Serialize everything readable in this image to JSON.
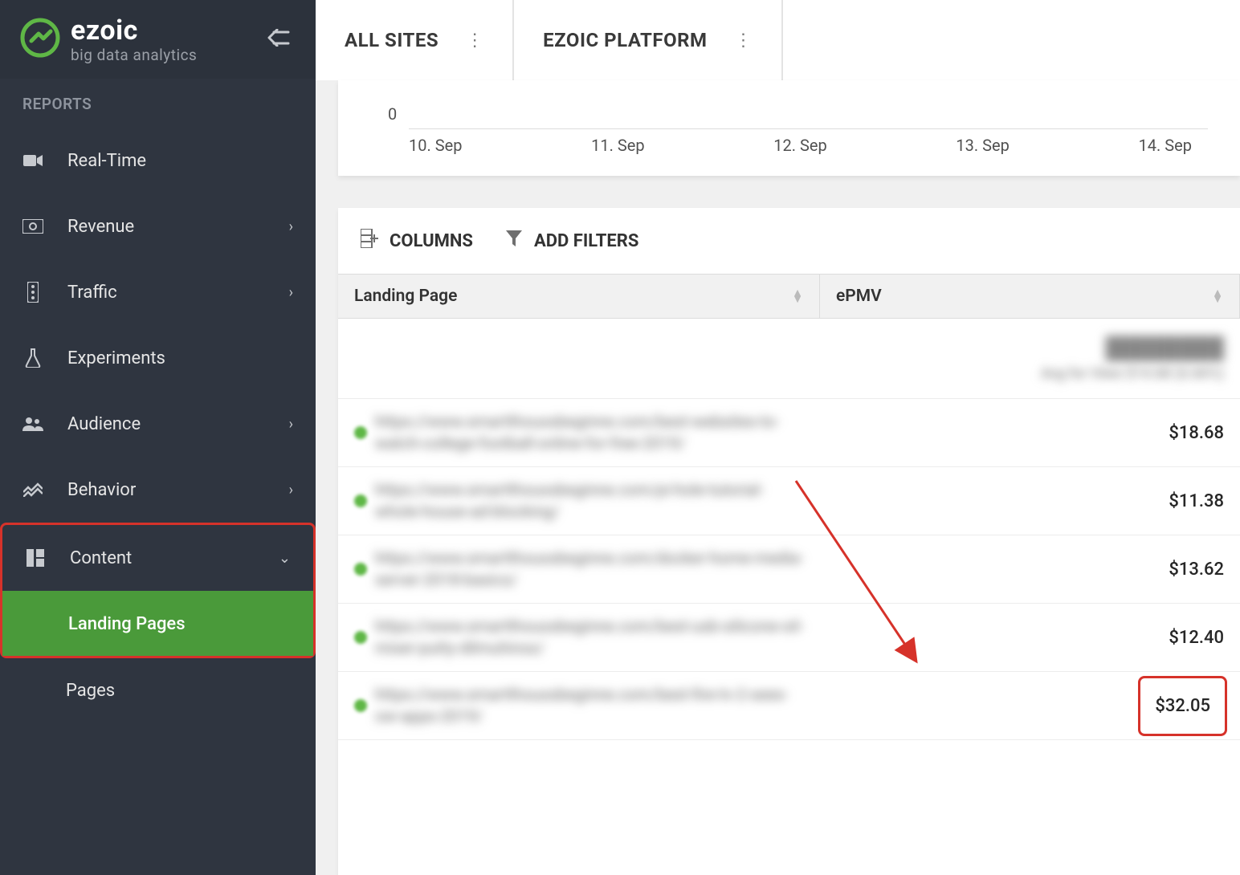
{
  "brand": {
    "name": "ezoic",
    "tagline": "big data analytics"
  },
  "sidebar": {
    "section": "REPORTS",
    "items": [
      {
        "label": "Real-Time",
        "icon": "video-icon"
      },
      {
        "label": "Revenue",
        "icon": "money-icon",
        "chevron": true
      },
      {
        "label": "Traffic",
        "icon": "traffic-icon",
        "chevron": true
      },
      {
        "label": "Experiments",
        "icon": "flask-icon"
      },
      {
        "label": "Audience",
        "icon": "people-icon",
        "chevron": true
      },
      {
        "label": "Behavior",
        "icon": "chart-icon",
        "chevron": true
      },
      {
        "label": "Content",
        "icon": "grid-icon",
        "chevron_down": true
      },
      {
        "label": "Landing Pages"
      },
      {
        "label": "Pages"
      }
    ]
  },
  "tabs": [
    {
      "label": "ALL SITES"
    },
    {
      "label": "EZOIC PLATFORM"
    }
  ],
  "chart": {
    "zero": "0",
    "ticks": [
      "10. Sep",
      "11. Sep",
      "12. Sep",
      "13. Sep",
      "14. Sep"
    ]
  },
  "toolbar": {
    "columns": "COLUMNS",
    "filters": "ADD FILTERS"
  },
  "table": {
    "headers": {
      "page": "Landing Page",
      "epmv": "ePMV"
    },
    "summary": {
      "page_blur": "████████",
      "epmv_blur": "Avg for View $14.68 (6.66%)"
    },
    "rows": [
      {
        "url_blur": "https://www.smartthoussbeginne.com/best-websites-to-watch-college-football-online-for-free-2019/",
        "epmv": "$18.68"
      },
      {
        "url_blur": "https://www.smartthoussbeginne.com/pi-hole-tutorial-whole-house-ad-blocking/",
        "epmv": "$11.38"
      },
      {
        "url_blur": "https://www.smartthoussbeginne.com/docker-home-media-server-2018-basics/",
        "epmv": "$13.62"
      },
      {
        "url_blur": "https://www.smartthoussbeginne.com/best-usb-silicone-oil-mixer-putty-dilmuhinss/",
        "epmv": "$12.40"
      },
      {
        "url_blur": "https://www.smartthoussbeginne.com/best-fire-tv-2-sees-ow-apps-2019/",
        "epmv": "$32.05"
      }
    ]
  },
  "chart_data": {
    "type": "line",
    "title": "",
    "xlabel": "",
    "ylabel": "",
    "categories": [
      "10. Sep",
      "11. Sep",
      "12. Sep",
      "13. Sep",
      "14. Sep"
    ],
    "values": [
      0,
      0,
      0,
      0,
      0
    ],
    "ylim": [
      0,
      0
    ]
  }
}
